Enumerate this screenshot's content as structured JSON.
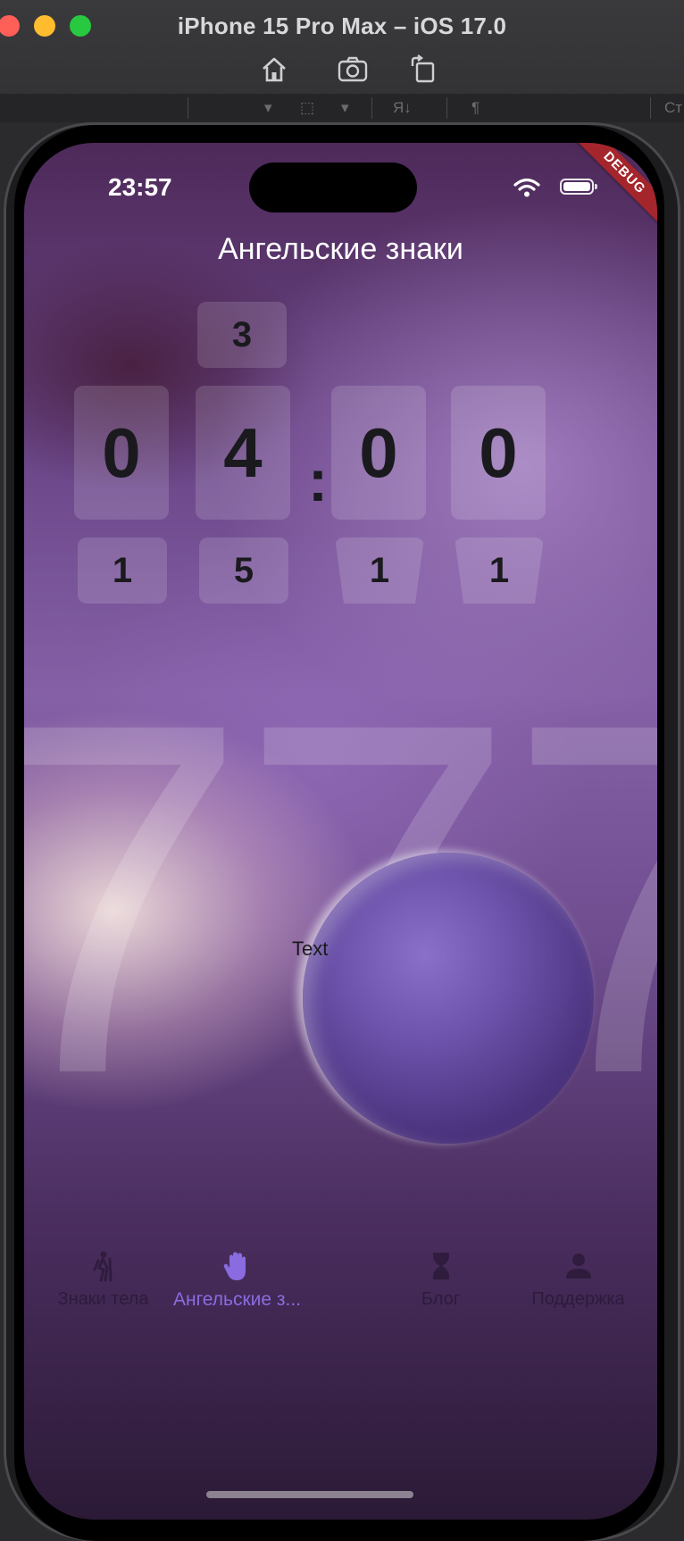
{
  "window": {
    "title": "iPhone 15 Pro Max – iOS 17.0",
    "toolbar": [
      {
        "icon": "home-icon"
      },
      {
        "icon": "screenshot-icon"
      },
      {
        "icon": "rotate-icon"
      }
    ],
    "strip": {
      "sort_label": "Я↓",
      "pilcrow": "¶",
      "right_label": "Ст"
    }
  },
  "status_bar": {
    "time": "23:57",
    "wifi_icon": "wifi-icon",
    "battery_icon": "battery-icon"
  },
  "debug_banner": "DEBUG",
  "app": {
    "title": "Ангельские знаки",
    "clock": {
      "top_digit": "3",
      "main_digits": [
        "0",
        "4",
        "0",
        "0"
      ],
      "separator": ":",
      "bottom_digits": [
        "1",
        "5",
        "1",
        "1"
      ]
    },
    "background_digits": [
      "7",
      "7",
      "7"
    ],
    "center_text": "Text"
  },
  "tabbar": {
    "tabs": [
      {
        "label": "Знаки тела",
        "icon": "hiker-icon",
        "active": false
      },
      {
        "label": "Ангельские з...",
        "icon": "hand-icon",
        "active": true
      },
      {
        "label": "Блог",
        "icon": "hourglass-icon",
        "active": false
      },
      {
        "label": "Поддержка",
        "icon": "person-icon",
        "active": false
      }
    ]
  },
  "colors": {
    "accent": "#8a6ce0",
    "debug": "#a4262c",
    "tile_text": "#1a1a1e"
  }
}
